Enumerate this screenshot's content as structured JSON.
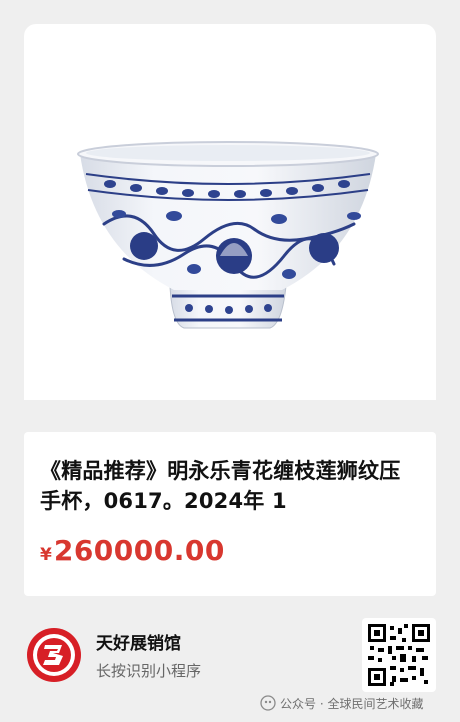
{
  "product": {
    "image_alt": "blue-and-white porcelain bowl",
    "title": "《精品推荐》明永乐青花缠枝莲狮纹压手杯，0617。2024年 1",
    "currency": "¥",
    "price": "260000.00"
  },
  "shop": {
    "name": "天好展销馆",
    "hint": "长按识别小程序"
  },
  "watermark": {
    "text": "公众号 · 全球民间艺术收藏"
  },
  "colors": {
    "price": "#d8372f",
    "background": "#efefef",
    "logo_red": "#d71f26"
  }
}
